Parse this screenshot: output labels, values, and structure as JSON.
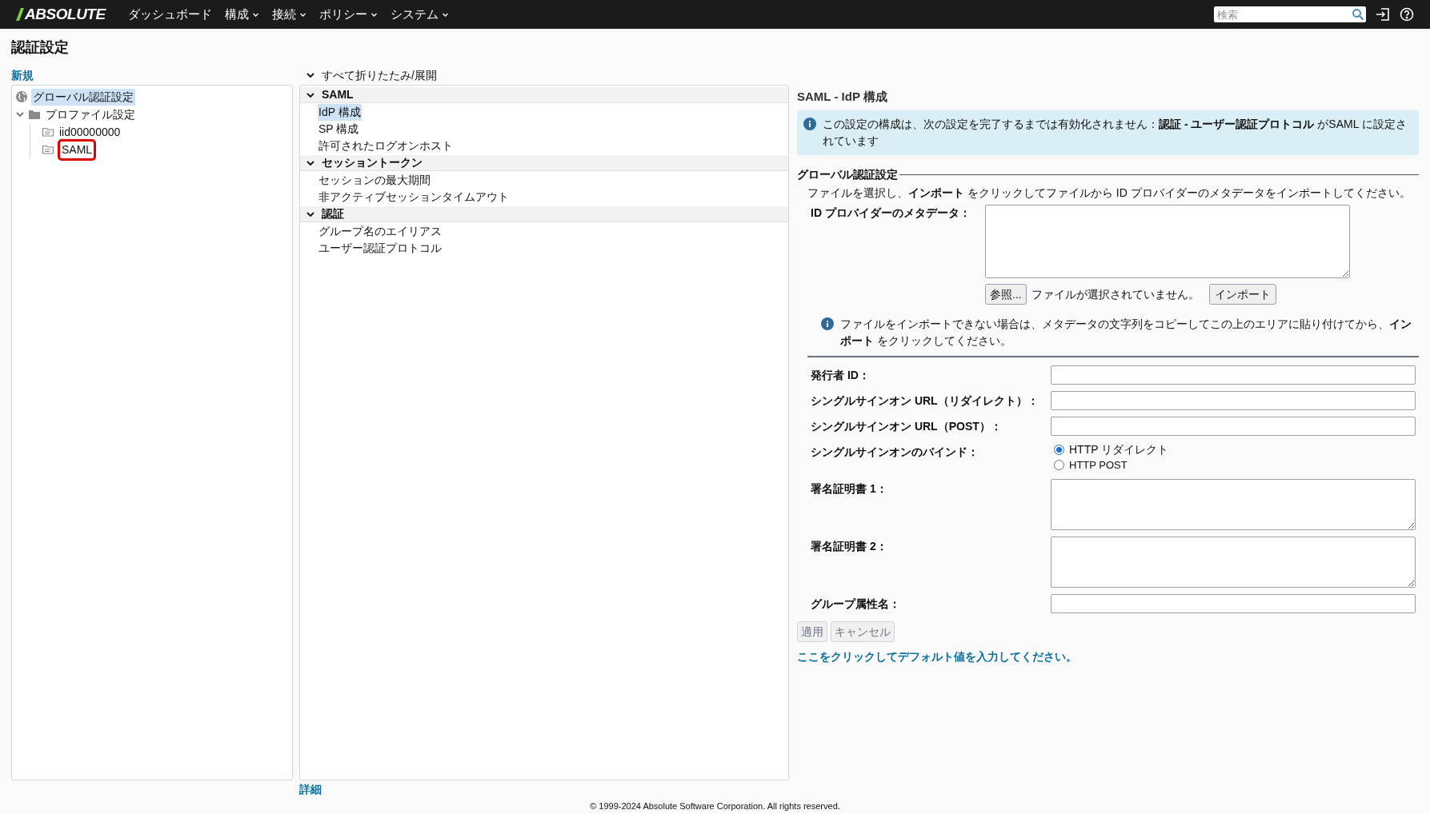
{
  "nav": {
    "logo": "ABSOLUTE",
    "menu": [
      {
        "label": "ダッシュボード",
        "dropdown": false
      },
      {
        "label": "構成",
        "dropdown": true
      },
      {
        "label": "接続",
        "dropdown": true
      },
      {
        "label": "ポリシー",
        "dropdown": true
      },
      {
        "label": "システム",
        "dropdown": true
      }
    ],
    "search": {
      "placeholder": "検索"
    }
  },
  "page_title": "認証設定",
  "new_link": "新規",
  "tree": [
    {
      "label": "グローバル認証設定",
      "kind": "globe",
      "selected": true,
      "marked": false
    },
    {
      "label": "プロファイル設定",
      "kind": "folder",
      "selected": false,
      "marked": false,
      "expanded": true,
      "children": [
        {
          "label": "iid00000000",
          "kind": "file",
          "selected": false,
          "marked": false
        },
        {
          "label": "SAML",
          "kind": "file",
          "selected": false,
          "marked": true
        }
      ]
    }
  ],
  "collapse_all": "すべて折りたたみ/展開",
  "sections": [
    {
      "title": "SAML",
      "expanded": true,
      "items": [
        {
          "label": "IdP 構成",
          "selected": true
        },
        {
          "label": "SP 構成",
          "selected": false
        },
        {
          "label": "許可されたログオンホスト",
          "selected": false
        }
      ]
    },
    {
      "title": "セッショントークン",
      "expanded": true,
      "items": [
        {
          "label": "セッションの最大期間",
          "selected": false
        },
        {
          "label": "非アクティブセッションタイムアウト",
          "selected": false
        }
      ]
    },
    {
      "title": "認証",
      "expanded": true,
      "items": [
        {
          "label": "グループ名のエイリアス",
          "selected": false
        },
        {
          "label": "ユーザー認証プロトコル",
          "selected": false
        }
      ]
    }
  ],
  "details_link": "詳細",
  "panel": {
    "heading": "SAML - IdP 構成",
    "alert": "この設定の構成は、次の設定を完了するまでは有効化されません：**認証 - ユーザー認証プロトコル** がSAML に設定されています",
    "legend": "グローバル認証設定",
    "instruction": "ファイルを選択し、**インポート** をクリックしてファイルから ID プロバイダーのメタデータをインポートしてください。",
    "metadata_label": "ID プロバイダーのメタデータ：",
    "browse_button": "参照...",
    "no_file": "ファイルが選択されていません。",
    "import_button": "インポート",
    "import_hint": "ファイルをインポートできない場合は、メタデータの文字列をコピーしてこの上のエリアに貼り付けてから、**インポート** をクリックしてください。",
    "fields": [
      {
        "kind": "text",
        "label": "発行者 ID："
      },
      {
        "kind": "text",
        "label": "シングルサインオン URL（リダイレクト）："
      },
      {
        "kind": "text",
        "label": "シングルサインオン URL（POST）："
      },
      {
        "kind": "radio",
        "label": "シングルサインオンのバインド：",
        "options": [
          {
            "label": "HTTP リダイレクト",
            "selected": true
          },
          {
            "label": "HTTP POST",
            "selected": false
          }
        ]
      },
      {
        "kind": "textarea",
        "label": "署名証明書 1："
      },
      {
        "kind": "textarea",
        "label": "署名証明書 2："
      },
      {
        "kind": "text",
        "label": "グループ属性名："
      }
    ],
    "buttons": [
      {
        "label": "適用",
        "disabled": true
      },
      {
        "label": "キャンセル",
        "disabled": true
      }
    ],
    "default_link": "ここをクリックしてデフォルト値を入力してください。"
  },
  "footer": "© 1999-2024 Absolute Software Corporation. All rights reserved."
}
